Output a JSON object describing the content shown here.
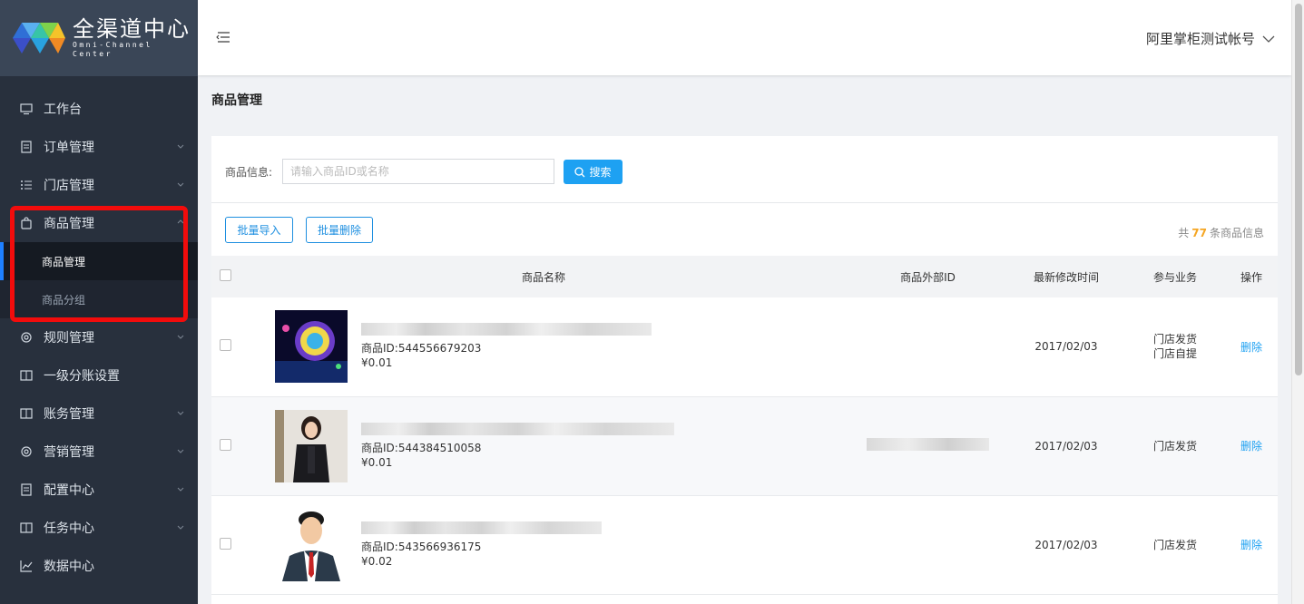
{
  "logo": {
    "title": "全渠道中心",
    "subtitle": "Omni-Channel Center"
  },
  "sidebar": {
    "items": [
      {
        "label": "工作台"
      },
      {
        "label": "订单管理"
      },
      {
        "label": "门店管理"
      },
      {
        "label": "商品管理",
        "expanded": true,
        "children": [
          {
            "label": "商品管理",
            "active": true
          },
          {
            "label": "商品分组"
          }
        ]
      },
      {
        "label": "规则管理"
      },
      {
        "label": "一级分账设置"
      },
      {
        "label": "账务管理"
      },
      {
        "label": "营销管理"
      },
      {
        "label": "配置中心"
      },
      {
        "label": "任务中心"
      },
      {
        "label": "数据中心"
      }
    ]
  },
  "header": {
    "account": "阿里掌柜测试帐号"
  },
  "page": {
    "title": "商品管理"
  },
  "search": {
    "label": "商品信息:",
    "placeholder": "请输入商品ID或名称",
    "button": "搜索"
  },
  "toolbar": {
    "import_label": "批量导入",
    "delete_label": "批量删除",
    "total_prefix": "共",
    "total_count": "77",
    "total_suffix": "条商品信息"
  },
  "table": {
    "columns": [
      "商品名称",
      "商品外部ID",
      "最新修改时间",
      "参与业务",
      "操作"
    ],
    "rows": [
      {
        "id_text": "商品ID:544556679203",
        "price": "¥0.01",
        "date": "2017/02/03",
        "biz1": "门店发货",
        "biz2": "门店自提",
        "action": "删除"
      },
      {
        "id_text": "商品ID:544384510058",
        "price": "¥0.01",
        "date": "2017/02/03",
        "biz1": "门店发货",
        "biz2": "",
        "action": "删除"
      },
      {
        "id_text": "商品ID:543566936175",
        "price": "¥0.02",
        "date": "2017/02/03",
        "biz1": "门店发货",
        "biz2": "",
        "action": "删除"
      }
    ]
  },
  "colors": {
    "sidebar_bg": "#28303d",
    "accent": "#1ea1f2",
    "highlight_box": "#f20c0c",
    "count": "#f5a623"
  }
}
